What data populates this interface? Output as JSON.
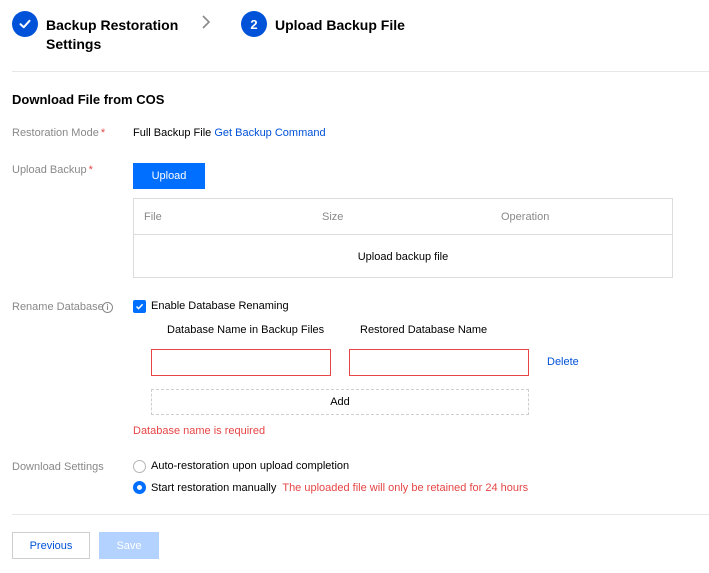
{
  "steps": [
    {
      "title_line1": "Backup Restoration",
      "title_line2": "Settings",
      "state": "done"
    },
    {
      "number": "2",
      "title": "Upload Backup File",
      "state": "active"
    }
  ],
  "section_title": "Download File from COS",
  "restoration_mode": {
    "label": "Restoration Mode",
    "value": "Full Backup File",
    "link": "Get Backup Command"
  },
  "upload_backup": {
    "label": "Upload Backup",
    "button": "Upload",
    "table": {
      "columns": [
        "File",
        "Size",
        "Operation"
      ],
      "empty_text": "Upload backup file"
    }
  },
  "rename_database": {
    "label": "Rename Database",
    "checkbox_label": "Enable Database Renaming",
    "checked": true,
    "col_source": "Database Name in Backup Files",
    "col_target": "Restored Database Name",
    "source_value": "",
    "target_value": "",
    "delete_label": "Delete",
    "add_label": "Add",
    "error": "Database name is required"
  },
  "download_settings": {
    "label": "Download Settings",
    "options": [
      {
        "label": "Auto-restoration upon upload completion",
        "selected": false
      },
      {
        "label": "Start restoration manually",
        "selected": true,
        "hint": "The uploaded file will only be retained for 24 hours"
      }
    ]
  },
  "footer": {
    "previous": "Previous",
    "save": "Save"
  },
  "colors": {
    "primary": "#006eff",
    "link": "#0052d9",
    "error": "#e54545",
    "disabled": "#b3d2ff"
  }
}
